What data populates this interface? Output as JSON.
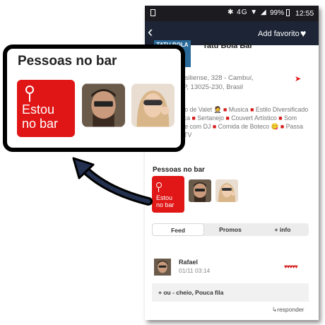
{
  "status_bar": {
    "network": "4G",
    "battery": "99%",
    "time": "12:55"
  },
  "header": {
    "back_icon": "chevron-left-icon",
    "favorite_label": "Add favorito",
    "heart_icon": "heart-icon"
  },
  "venue": {
    "logo_text": "TATU BOLA",
    "name": "Tatu Bola Bar",
    "address_line1": "Brasiliense, 328 - Cambuí,",
    "address_line2": "- SP, 13025-230, Brasil"
  },
  "features_text": [
    "Serviço de Valet",
    "Musica",
    "Estilo Diversificado de Música",
    "Sertanejo",
    "Couvert Artístico",
    "Som Ambiente com DJ",
    "Comida de Boteco",
    "Passa jogo na TV"
  ],
  "people": {
    "section_title": "Pessoas no bar",
    "estou_line1": "Estou",
    "estou_line2": "no bar"
  },
  "tabs": [
    {
      "label": "Feed",
      "active": true
    },
    {
      "label": "Promos",
      "active": false
    },
    {
      "label": "+ info",
      "active": false
    }
  ],
  "post": {
    "user": "Rafael",
    "time": "01/11 03:14",
    "rating_hearts": 5,
    "comment": "+ ou - cheio, Pouca fila",
    "reply_label": "↳responder"
  },
  "zoom": {
    "title": "Pessoas no bar",
    "estou_line1": "Estou",
    "estou_line2": "no bar"
  },
  "colors": {
    "accent": "#e11616",
    "navbar": "#1c2435"
  }
}
